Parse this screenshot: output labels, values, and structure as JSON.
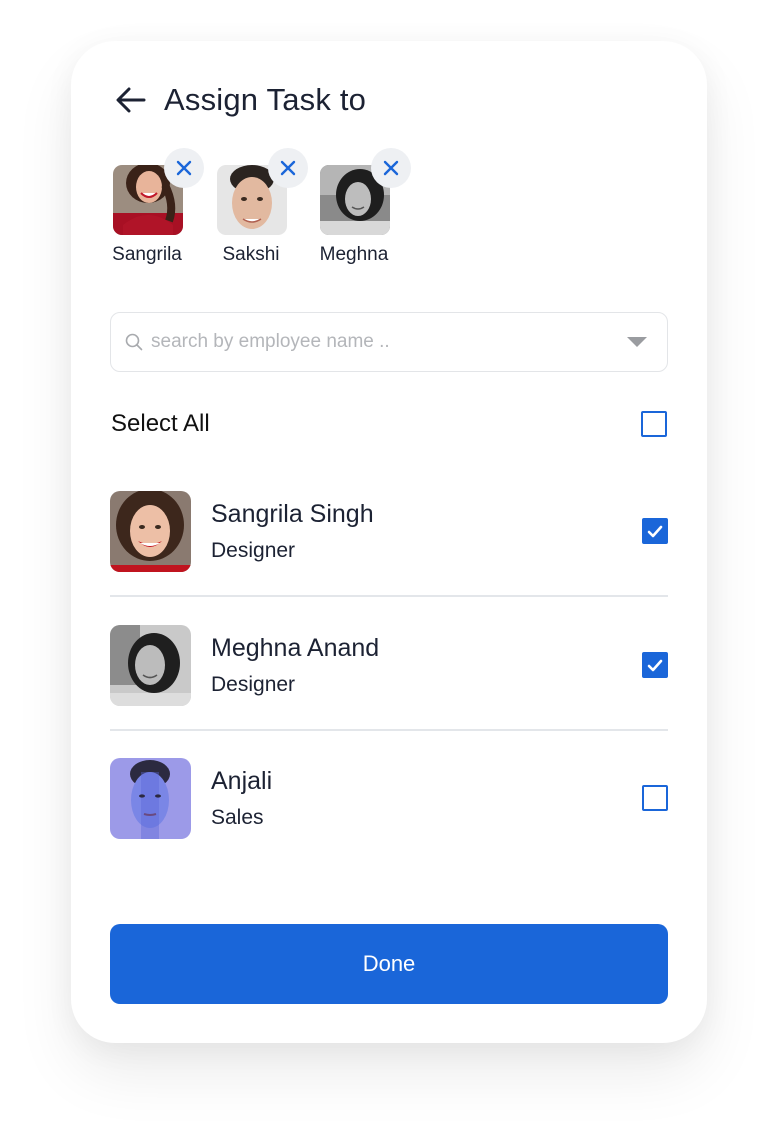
{
  "header": {
    "title": "Assign Task to",
    "back_icon": "arrow-left-icon"
  },
  "selected_chips": [
    {
      "name": "Sangrila",
      "remove_icon": "close-icon"
    },
    {
      "name": "Sakshi",
      "remove_icon": "close-icon"
    },
    {
      "name": "Meghna",
      "remove_icon": "close-icon"
    }
  ],
  "search": {
    "value": "",
    "placeholder": "search by employee name ..",
    "icon": "search-icon",
    "dropdown_icon": "caret-down-icon"
  },
  "select_all": {
    "label": "Select All",
    "checked": false
  },
  "employees": [
    {
      "name": "Sangrila Singh",
      "role": "Designer",
      "checked": true
    },
    {
      "name": "Meghna Anand",
      "role": "Designer",
      "checked": true
    },
    {
      "name": "Anjali",
      "role": "Sales",
      "checked": false
    }
  ],
  "actions": {
    "done_label": "Done"
  },
  "colors": {
    "primary": "#1a66d9",
    "text": "#1c2233",
    "divider": "#e3e6ea",
    "chip_close_bg": "#eef0f3"
  }
}
